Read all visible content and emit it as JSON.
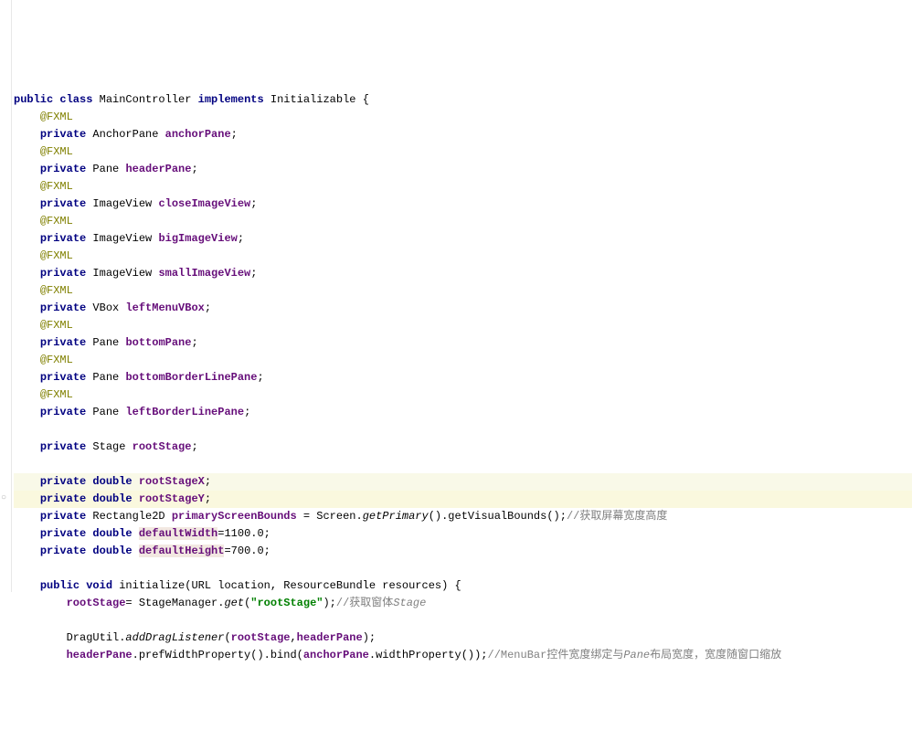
{
  "lines": {
    "l0": {
      "i": 0,
      "t": [
        [
          "kw",
          "public class "
        ],
        [
          "",
          "MainController "
        ],
        [
          "kw",
          "implements "
        ],
        [
          "",
          "Initializable {"
        ]
      ]
    },
    "l1": {
      "i": 1,
      "t": [
        [
          "ann",
          "@FXML"
        ]
      ]
    },
    "l2": {
      "i": 1,
      "t": [
        [
          "kw",
          "private "
        ],
        [
          "",
          "AnchorPane "
        ],
        [
          "field",
          "anchorPane"
        ],
        [
          "",
          ";"
        ]
      ]
    },
    "l3": {
      "i": 1,
      "t": [
        [
          "ann",
          "@FXML"
        ]
      ]
    },
    "l4": {
      "i": 1,
      "t": [
        [
          "kw",
          "private "
        ],
        [
          "",
          "Pane "
        ],
        [
          "field",
          "headerPane"
        ],
        [
          "",
          ";"
        ]
      ]
    },
    "l5": {
      "i": 1,
      "t": [
        [
          "ann",
          "@FXML"
        ]
      ]
    },
    "l6": {
      "i": 1,
      "t": [
        [
          "kw",
          "private "
        ],
        [
          "",
          "ImageView "
        ],
        [
          "field",
          "closeImageView"
        ],
        [
          "",
          ";"
        ]
      ]
    },
    "l7": {
      "i": 1,
      "t": [
        [
          "ann",
          "@FXML"
        ]
      ]
    },
    "l8": {
      "i": 1,
      "t": [
        [
          "kw",
          "private "
        ],
        [
          "",
          "ImageView "
        ],
        [
          "field",
          "bigImageView"
        ],
        [
          "",
          ";"
        ]
      ]
    },
    "l9": {
      "i": 1,
      "t": [
        [
          "ann",
          "@FXML"
        ]
      ]
    },
    "l10": {
      "i": 1,
      "t": [
        [
          "kw",
          "private "
        ],
        [
          "",
          "ImageView "
        ],
        [
          "field",
          "smallImageView"
        ],
        [
          "",
          ";"
        ]
      ]
    },
    "l11": {
      "i": 1,
      "t": [
        [
          "ann",
          "@FXML"
        ]
      ]
    },
    "l12": {
      "i": 1,
      "t": [
        [
          "kw",
          "private "
        ],
        [
          "",
          "VBox "
        ],
        [
          "field",
          "leftMenuVBox"
        ],
        [
          "",
          ";"
        ]
      ]
    },
    "l13": {
      "i": 1,
      "t": [
        [
          "ann",
          "@FXML"
        ]
      ]
    },
    "l14": {
      "i": 1,
      "t": [
        [
          "kw",
          "private "
        ],
        [
          "",
          "Pane "
        ],
        [
          "field",
          "bottomPane"
        ],
        [
          "",
          ";"
        ]
      ]
    },
    "l15": {
      "i": 1,
      "t": [
        [
          "ann",
          "@FXML"
        ]
      ]
    },
    "l16": {
      "i": 1,
      "t": [
        [
          "kw",
          "private "
        ],
        [
          "",
          "Pane "
        ],
        [
          "field",
          "bottomBorderLinePane"
        ],
        [
          "",
          ";"
        ]
      ]
    },
    "l17": {
      "i": 1,
      "t": [
        [
          "ann",
          "@FXML"
        ]
      ]
    },
    "l18": {
      "i": 1,
      "t": [
        [
          "kw",
          "private "
        ],
        [
          "",
          "Pane "
        ],
        [
          "field",
          "leftBorderLinePane"
        ],
        [
          "",
          ";"
        ]
      ]
    },
    "l19": {
      "i": 1,
      "t": [
        [
          "",
          ""
        ]
      ]
    },
    "l20": {
      "i": 1,
      "t": [
        [
          "kw",
          "private "
        ],
        [
          "",
          "Stage "
        ],
        [
          "field",
          "rootStage"
        ],
        [
          "",
          ";"
        ]
      ]
    },
    "l21": {
      "i": 1,
      "t": [
        [
          "",
          ""
        ]
      ]
    },
    "l22": {
      "i": 1,
      "t": [
        [
          "kw",
          "private double "
        ],
        [
          "field",
          "rootStageX"
        ],
        [
          "",
          ";"
        ]
      ],
      "hl": "hl"
    },
    "l23": {
      "i": 1,
      "t": [
        [
          "kw",
          "private double "
        ],
        [
          "field",
          "rootStageY"
        ],
        [
          "",
          ";"
        ]
      ],
      "hl": "hl2"
    },
    "l24": {
      "i": 1,
      "t": [
        [
          "kw",
          "private "
        ],
        [
          "",
          "Rectangle2D "
        ],
        [
          "field",
          "primaryScreenBounds"
        ],
        [
          "",
          " = Screen."
        ],
        [
          "static",
          "getPrimary"
        ],
        [
          "",
          "().getVisualBounds();"
        ],
        [
          "cmt",
          "//获取屏幕宽度高度"
        ]
      ]
    },
    "l25": {
      "i": 1,
      "t": [
        [
          "kw",
          "private double "
        ],
        [
          "warn",
          "defaultWidth"
        ],
        [
          "",
          "=1100.0;"
        ]
      ]
    },
    "l26": {
      "i": 1,
      "t": [
        [
          "kw",
          "private double "
        ],
        [
          "warn",
          "defaultHeight"
        ],
        [
          "",
          "=700.0;"
        ]
      ]
    },
    "l27": {
      "i": 1,
      "t": [
        [
          "",
          ""
        ]
      ]
    },
    "l28": {
      "i": 1,
      "t": [
        [
          "kw",
          "public void "
        ],
        [
          "",
          "initialize(URL location, ResourceBundle resources) {"
        ]
      ]
    },
    "l29": {
      "i": 2,
      "t": [
        [
          "field",
          "rootStage"
        ],
        [
          "",
          "= StageManager."
        ],
        [
          "static",
          "get"
        ],
        [
          "",
          "("
        ],
        [
          "str",
          "\"rootStage\""
        ],
        [
          "",
          ");"
        ],
        [
          "cmt",
          "//获取窗体"
        ],
        [
          "cmt cmt-i",
          "Stage"
        ]
      ]
    },
    "l30": {
      "i": 2,
      "t": [
        [
          "",
          ""
        ]
      ]
    },
    "l31": {
      "i": 2,
      "t": [
        [
          "",
          "DragUtil."
        ],
        [
          "static",
          "addDragListener"
        ],
        [
          "",
          "("
        ],
        [
          "field",
          "rootStage"
        ],
        [
          "",
          ","
        ],
        [
          "field",
          "headerPane"
        ],
        [
          "",
          ");"
        ]
      ]
    },
    "l32": {
      "i": 2,
      "t": [
        [
          "field",
          "headerPane"
        ],
        [
          "",
          ".prefWidthProperty().bind("
        ],
        [
          "field",
          "anchorPane"
        ],
        [
          "",
          ".widthProperty());"
        ],
        [
          "cmt",
          "//MenuBar"
        ],
        [
          "cmt",
          "控件宽度绑定与"
        ],
        [
          "cmt cmt-i",
          "Pane"
        ],
        [
          "cmt",
          "布局宽度，宽度随窗口缩放"
        ]
      ]
    }
  }
}
